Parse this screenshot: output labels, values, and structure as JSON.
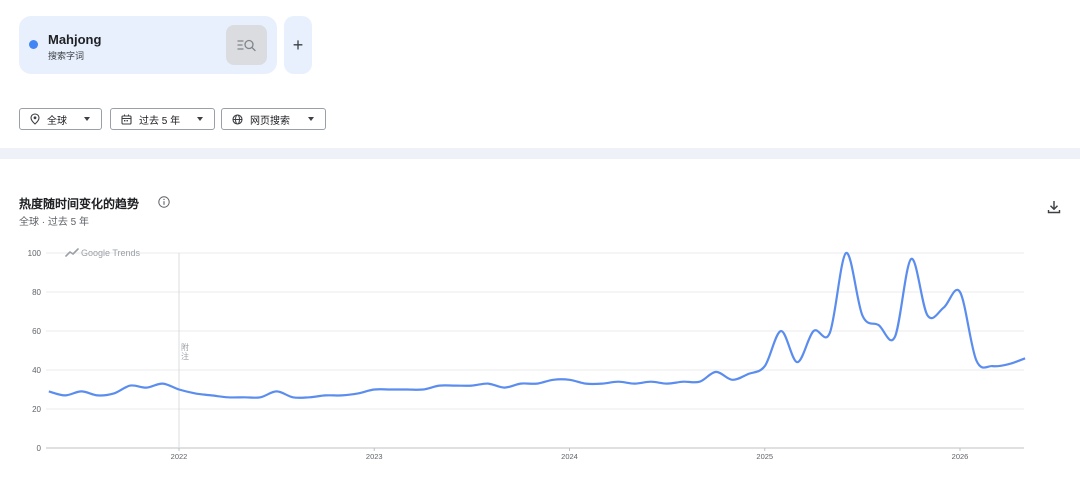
{
  "term": {
    "name": "Mahjong",
    "type": "搜索字词",
    "add_label": "+"
  },
  "filters": {
    "region": "全球",
    "period": "过去 5 年",
    "property": "网页搜索"
  },
  "chart_header": {
    "title": "热度随时间变化的趋势",
    "subtitle": "全球 · 过去 5 年"
  },
  "colors": {
    "accent": "#4285f4",
    "line": "#5b8def",
    "card_bg": "#e8f0fe"
  },
  "icons": [
    "search-list-icon",
    "location-pin-icon",
    "calendar-icon",
    "globe-icon",
    "info-icon",
    "download-icon",
    "google-trends-icon"
  ],
  "chart_data": {
    "type": "line",
    "watermark": "Google Trends",
    "note_label": "附注",
    "ylim": [
      0,
      100
    ],
    "y_ticks": [
      0,
      20,
      40,
      60,
      80,
      100
    ],
    "x_ticks": [
      "2022",
      "2023",
      "2024",
      "2025",
      "2026"
    ],
    "note_date": "2022-01",
    "grid": true,
    "series": [
      {
        "name": "Mahjong",
        "points": [
          [
            "2021-05",
            29
          ],
          [
            "2021-06",
            27
          ],
          [
            "2021-07",
            29
          ],
          [
            "2021-08",
            27
          ],
          [
            "2021-09",
            28
          ],
          [
            "2021-10",
            32
          ],
          [
            "2021-11",
            31
          ],
          [
            "2021-12",
            33
          ],
          [
            "2022-01",
            30
          ],
          [
            "2022-02",
            28
          ],
          [
            "2022-03",
            27
          ],
          [
            "2022-04",
            26
          ],
          [
            "2022-05",
            26
          ],
          [
            "2022-06",
            26
          ],
          [
            "2022-07",
            29
          ],
          [
            "2022-08",
            26
          ],
          [
            "2022-09",
            26
          ],
          [
            "2022-10",
            27
          ],
          [
            "2022-11",
            27
          ],
          [
            "2022-12",
            28
          ],
          [
            "2023-01",
            30
          ],
          [
            "2023-02",
            30
          ],
          [
            "2023-03",
            30
          ],
          [
            "2023-04",
            30
          ],
          [
            "2023-05",
            32
          ],
          [
            "2023-06",
            32
          ],
          [
            "2023-07",
            32
          ],
          [
            "2023-08",
            33
          ],
          [
            "2023-09",
            31
          ],
          [
            "2023-10",
            33
          ],
          [
            "2023-11",
            33
          ],
          [
            "2023-12",
            35
          ],
          [
            "2024-01",
            35
          ],
          [
            "2024-02",
            33
          ],
          [
            "2024-03",
            33
          ],
          [
            "2024-04",
            34
          ],
          [
            "2024-05",
            33
          ],
          [
            "2024-06",
            34
          ],
          [
            "2024-07",
            33
          ],
          [
            "2024-08",
            34
          ],
          [
            "2024-09",
            34
          ],
          [
            "2024-10",
            39
          ],
          [
            "2024-11",
            35
          ],
          [
            "2024-12",
            38
          ],
          [
            "2025-01",
            42
          ],
          [
            "2025-02",
            60
          ],
          [
            "2025-03",
            44
          ],
          [
            "2025-04",
            60
          ],
          [
            "2025-05",
            59
          ],
          [
            "2025-06",
            100
          ],
          [
            "2025-07",
            68
          ],
          [
            "2025-08",
            63
          ],
          [
            "2025-09",
            57
          ],
          [
            "2025-10",
            97
          ],
          [
            "2025-11",
            68
          ],
          [
            "2025-12",
            72
          ],
          [
            "2026-01",
            80
          ],
          [
            "2026-02",
            45
          ],
          [
            "2026-03",
            42
          ],
          [
            "2026-04",
            43
          ],
          [
            "2026-05",
            46
          ]
        ]
      }
    ]
  }
}
